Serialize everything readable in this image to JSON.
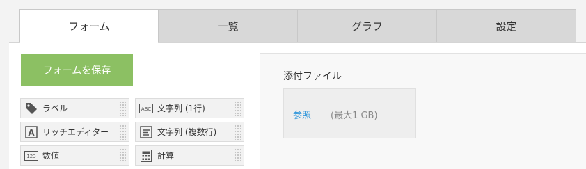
{
  "tabs": [
    {
      "label": "フォーム",
      "active": true
    },
    {
      "label": "一覧",
      "active": false
    },
    {
      "label": "グラフ",
      "active": false
    },
    {
      "label": "設定",
      "active": false
    }
  ],
  "save_button": {
    "label": "フォームを保存",
    "color": "#8cc063"
  },
  "palette": [
    {
      "label": "ラベル",
      "icon": "tag-icon"
    },
    {
      "label": "文字列 (1行)",
      "icon": "abc-icon"
    },
    {
      "label": "リッチエディター",
      "icon": "rich-editor-icon"
    },
    {
      "label": "文字列 (複数行)",
      "icon": "multiline-text-icon"
    },
    {
      "label": "数値",
      "icon": "number-icon"
    },
    {
      "label": "計算",
      "icon": "calculator-icon"
    }
  ],
  "form_canvas": {
    "field_label": "添付ファイル",
    "browse_link": "参照",
    "max_size": "(最大1 GB)",
    "link_color": "#3498db"
  }
}
